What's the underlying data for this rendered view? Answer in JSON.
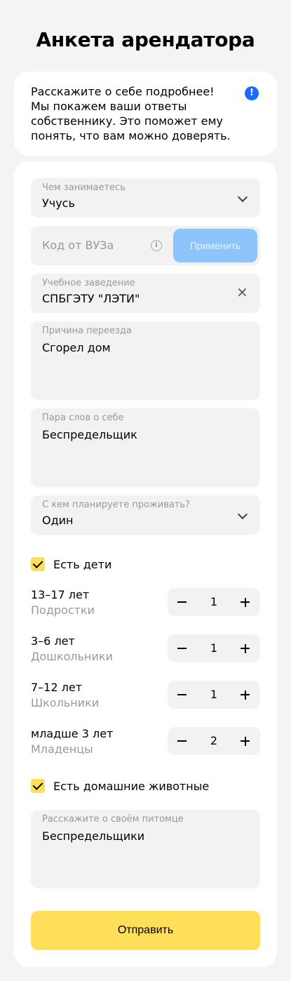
{
  "page": {
    "title": "Анкета арендатора"
  },
  "info": {
    "text": "Расскажите о себе подробнее! Мы покажем ваши ответы собственнику. Это поможет ему понять, что вам можно доверять.",
    "icon": "exclamation-icon",
    "icon_glyph": "!",
    "accent": "#1a6bff"
  },
  "form": {
    "occupation": {
      "label": "Чем занимаетесь",
      "value": "Учусь"
    },
    "university_code": {
      "placeholder": "Код от ВУЗа",
      "info_glyph": "i",
      "apply_label": "Применить"
    },
    "institution": {
      "label": "Учебное заведение",
      "value": "СПБГЭТУ \"ЛЭТИ\"",
      "clear_glyph": "×"
    },
    "move_reason": {
      "label": "Причина переезда",
      "value": "Сгорел дом"
    },
    "about": {
      "label": "Пара слов о себе",
      "value": "Беспредельщик"
    },
    "cohabitants": {
      "label": "С кем планируете проживать?",
      "value": "Один"
    },
    "has_children": {
      "label": "Есть дети",
      "checked": true
    },
    "children": [
      {
        "title": "13–17 лет",
        "subtitle": "Подростки",
        "count": "1"
      },
      {
        "title": "3–6 лет",
        "subtitle": "Дошкольники",
        "count": "1"
      },
      {
        "title": "7–12 лет",
        "subtitle": "Школьники",
        "count": "1"
      },
      {
        "title": "младше 3 лет",
        "subtitle": "Младенцы",
        "count": "2"
      }
    ],
    "has_pets": {
      "label": "Есть домашние животные",
      "checked": true
    },
    "pet_about": {
      "label": "Расскажите о своём питомце",
      "value": "Беспредельщики"
    },
    "submit_label": "Отправить"
  },
  "colors": {
    "accent_yellow": "#ffde5a",
    "apply_disabled": "#8cc4fb",
    "field_bg": "#f2f2f2",
    "page_bg": "#f4f4f4"
  }
}
